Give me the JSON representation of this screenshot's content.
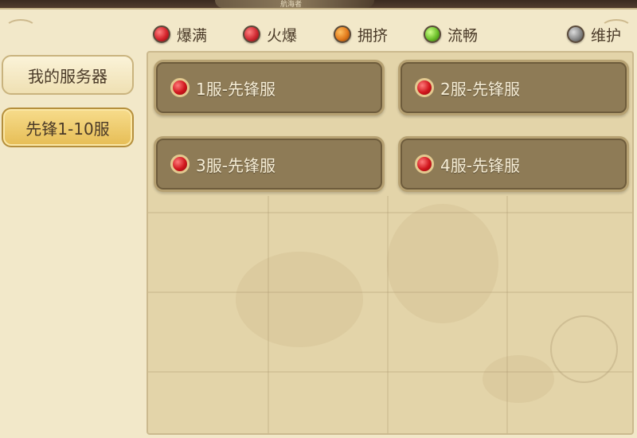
{
  "banner_text": "航海者",
  "legend": [
    {
      "label": "爆满",
      "color": "#d4232b"
    },
    {
      "label": "火爆",
      "color": "#cf2a32"
    },
    {
      "label": "拥挤",
      "color": "#e27a1c"
    },
    {
      "label": "流畅",
      "color": "#6cbf2a"
    },
    {
      "label": "维护",
      "color": "#8a8a8a"
    }
  ],
  "tabs": [
    {
      "label": "我的服务器",
      "selected": false
    },
    {
      "label": "先锋1-10服",
      "selected": true
    }
  ],
  "servers": [
    {
      "name": "1服-先锋服",
      "status": "爆满"
    },
    {
      "name": "2服-先锋服",
      "status": "爆满"
    },
    {
      "name": "3服-先锋服",
      "status": "爆满"
    },
    {
      "name": "4服-先锋服",
      "status": "爆满"
    }
  ]
}
